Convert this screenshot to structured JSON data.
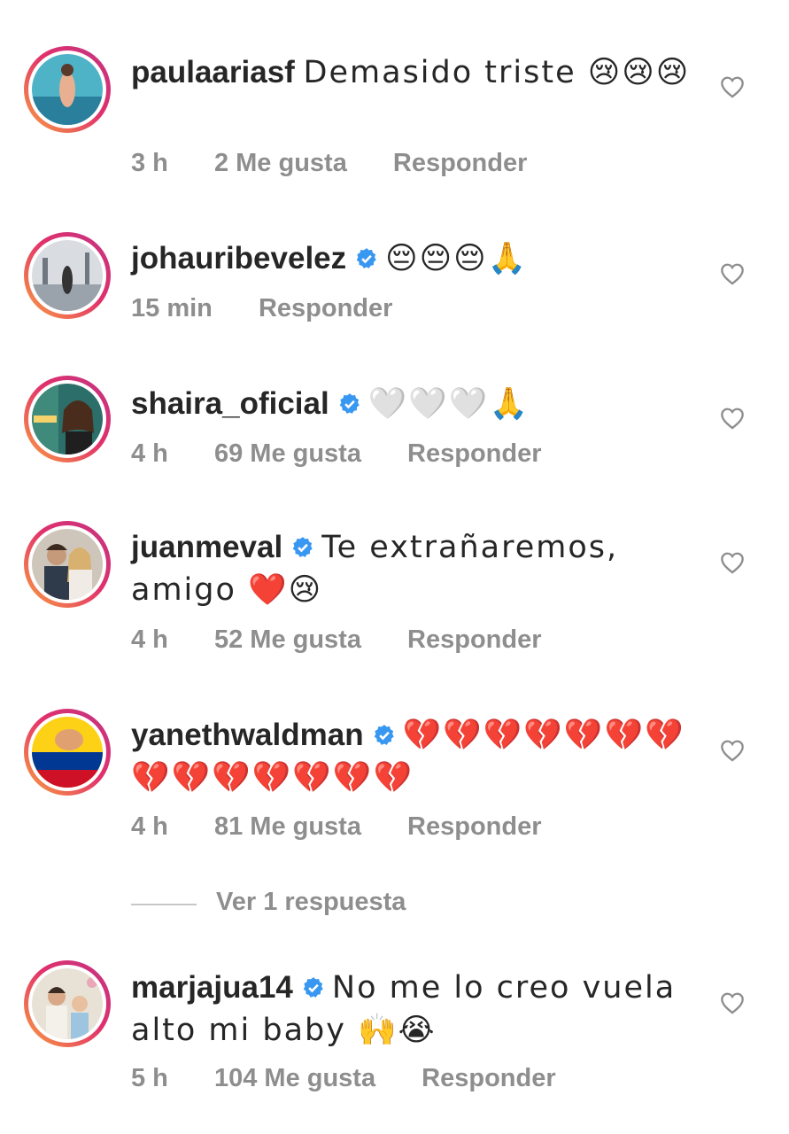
{
  "comments": [
    {
      "username": "paulaariasf",
      "verified": false,
      "text": "Demasido triste 😢😢😢",
      "time": "3 h",
      "likes": "2 Me gusta",
      "reply": "Responder"
    },
    {
      "username": "johauribevelez",
      "verified": true,
      "text": "😔😔😔🙏",
      "time": "15 min",
      "likes": "",
      "reply": "Responder"
    },
    {
      "username": "shaira_oficial",
      "verified": true,
      "text": "🤍🤍🤍🙏",
      "time": "4 h",
      "likes": "69 Me gusta",
      "reply": "Responder"
    },
    {
      "username": "juanmeval",
      "verified": true,
      "text": "Te extrañaremos, amigo ❤️😢",
      "time": "4 h",
      "likes": "52 Me gusta",
      "reply": "Responder"
    },
    {
      "username": "yanethwaldman",
      "verified": true,
      "text": "💔💔💔💔💔💔💔💔💔💔💔💔💔💔",
      "time": "4 h",
      "likes": "81 Me gusta",
      "reply": "Responder"
    },
    {
      "username": "marjajua14",
      "verified": true,
      "text": "No me lo creo vuela alto mi baby 🙌😭",
      "time": "5 h",
      "likes": "104 Me gusta",
      "reply": "Responder"
    }
  ],
  "view_replies": "Ver 1 respuesta",
  "icons": {
    "like": "heart-outline-icon",
    "verified": "verified-badge-icon"
  },
  "colors": {
    "text": "#262626",
    "meta": "#8e8e8e",
    "verified": "#3897f0"
  }
}
